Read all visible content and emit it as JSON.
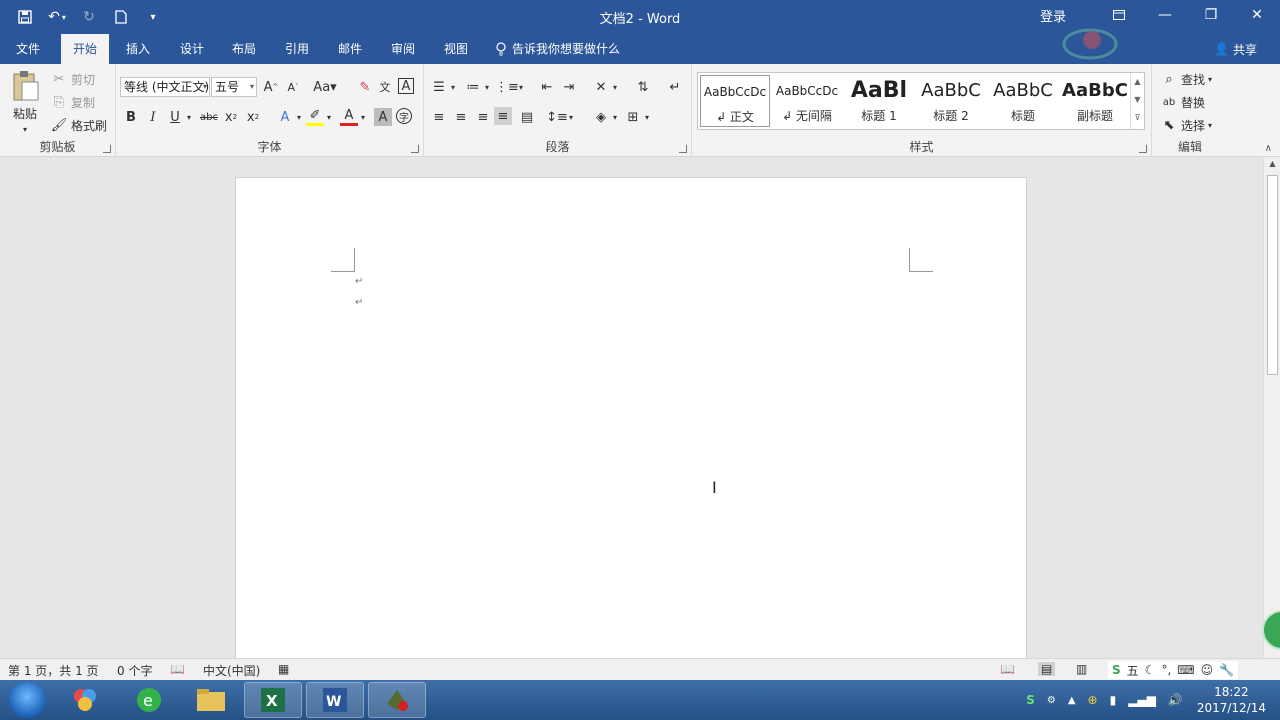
{
  "window": {
    "title": "文档2  -  Word",
    "signin": "登录"
  },
  "tabs": [
    "文件",
    "开始",
    "插入",
    "设计",
    "布局",
    "引用",
    "邮件",
    "审阅",
    "视图"
  ],
  "tellme": "告诉我你想要做什么",
  "share": "共享",
  "ribbon": {
    "clipboard": {
      "paste": "粘贴",
      "cut": "剪切",
      "copy": "复制",
      "format_painter": "格式刷",
      "label": "剪贴板"
    },
    "font": {
      "family": "等线 (中文正文)",
      "size": "五号",
      "label": "字体"
    },
    "paragraph": {
      "label": "段落"
    },
    "styles": {
      "label": "样式",
      "items": [
        {
          "sample": "AaBbCcDc",
          "name": "↲ 正文"
        },
        {
          "sample": "AaBbCcDc",
          "name": "↲ 无间隔"
        },
        {
          "sample": "AaBl",
          "name": "标题 1"
        },
        {
          "sample": "AaBbC",
          "name": "标题 2"
        },
        {
          "sample": "AaBbC",
          "name": "标题"
        },
        {
          "sample": "AaBbC",
          "name": "副标题"
        }
      ]
    },
    "editing": {
      "find": "查找",
      "replace": "替换",
      "select": "选择",
      "label": "编辑"
    }
  },
  "status": {
    "page": "第 1 页，共 1 页",
    "words": "0 个字",
    "language": "中文(中国)"
  },
  "taskbar": {
    "time": "18:22",
    "date": "2017/12/14"
  }
}
